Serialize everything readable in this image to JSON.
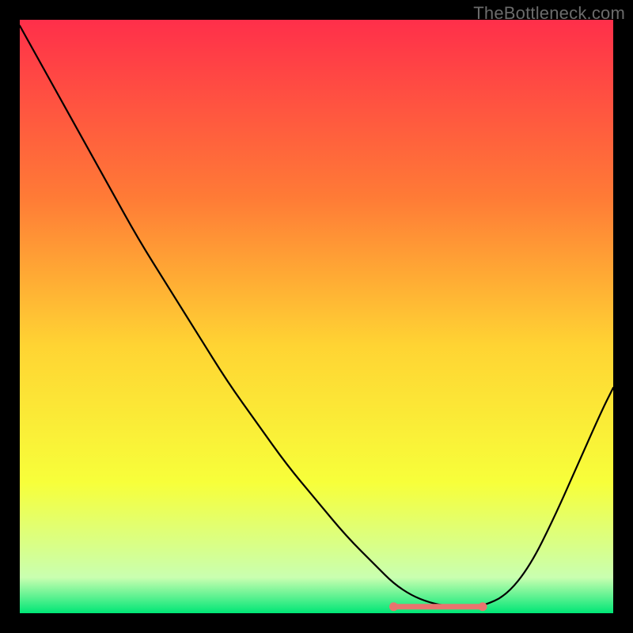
{
  "watermark": "TheBottleneck.com",
  "colors": {
    "frame_background": "#000000",
    "gradient_top": "#ff2f4a",
    "gradient_mid1": "#ff7b36",
    "gradient_mid2": "#ffd433",
    "gradient_mid3": "#f7ff3a",
    "gradient_low": "#c9ffb0",
    "gradient_bottom": "#00e676",
    "curve": "#000000",
    "highlight_stroke": "#e9746e",
    "highlight_dot": "#e9746e"
  },
  "chart_data": {
    "type": "line",
    "title": "",
    "xlabel": "",
    "ylabel": "",
    "xlim": [
      0,
      100
    ],
    "ylim": [
      0,
      100
    ],
    "x": [
      0,
      5,
      10,
      15,
      20,
      25,
      30,
      35,
      40,
      45,
      50,
      55,
      60,
      63,
      66,
      69,
      72,
      75,
      78,
      82,
      86,
      90,
      94,
      98,
      100
    ],
    "y": [
      99,
      90,
      81,
      72,
      63,
      55,
      47,
      39,
      32,
      25,
      19,
      13,
      8,
      5,
      3,
      1.8,
      1.2,
      1.0,
      1.2,
      3,
      8,
      16,
      25,
      34,
      38
    ],
    "highlight_segment": {
      "x_start": 63,
      "x_end": 78,
      "y": 1.1
    }
  }
}
